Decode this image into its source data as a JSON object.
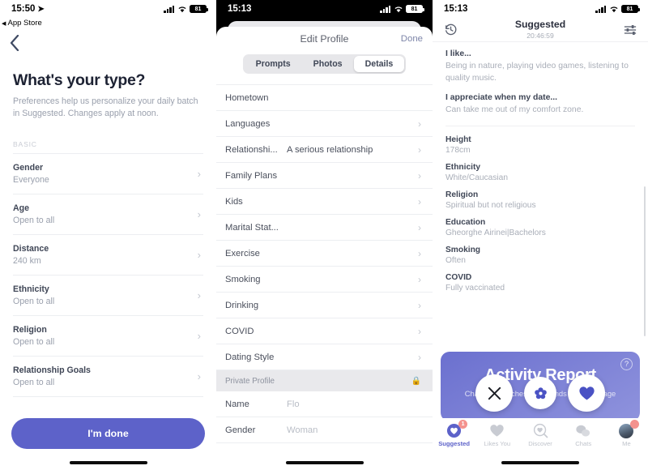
{
  "screen1": {
    "status": {
      "time": "15:50",
      "back_app": "App Store",
      "battery": "81"
    },
    "back_icon": "chevron-left-icon",
    "title": "What's your type?",
    "subtitle": "Preferences help us personalize your daily batch in Suggested. Changes apply at noon.",
    "section_label": "BASIC",
    "rows": [
      {
        "label": "Gender",
        "value": "Everyone"
      },
      {
        "label": "Age",
        "value": "Open to all"
      },
      {
        "label": "Distance",
        "value": "240 km"
      },
      {
        "label": "Ethnicity",
        "value": "Open to all"
      },
      {
        "label": "Religion",
        "value": "Open to all"
      },
      {
        "label": "Relationship Goals",
        "value": "Open to all"
      }
    ],
    "cta_label": "I'm done",
    "accent": "#5d62c9"
  },
  "screen2": {
    "status": {
      "time": "15:13",
      "battery": "81"
    },
    "sheet_title": "Edit Profile",
    "done_label": "Done",
    "tabs": [
      {
        "label": "Prompts",
        "active": false
      },
      {
        "label": "Photos",
        "active": false
      },
      {
        "label": "Details",
        "active": true
      }
    ],
    "rows": [
      {
        "label": "Hometown",
        "value": "",
        "chevron": false
      },
      {
        "label": "Languages",
        "value": "",
        "chevron": true
      },
      {
        "label": "Relationshi...",
        "value": "A serious relationship",
        "chevron": true
      },
      {
        "label": "Family Plans",
        "value": "",
        "chevron": true
      },
      {
        "label": "Kids",
        "value": "",
        "chevron": true
      },
      {
        "label": "Marital Stat...",
        "value": "",
        "chevron": true
      },
      {
        "label": "Exercise",
        "value": "",
        "chevron": true
      },
      {
        "label": "Smoking",
        "value": "",
        "chevron": true
      },
      {
        "label": "Drinking",
        "value": "",
        "chevron": true
      },
      {
        "label": "COVID",
        "value": "",
        "chevron": true
      },
      {
        "label": "Dating Style",
        "value": "",
        "chevron": true
      }
    ],
    "private_section": {
      "label": "Private Profile",
      "icon": "lock-icon"
    },
    "private_rows": [
      {
        "label": "Name",
        "value": "Flo"
      },
      {
        "label": "Gender",
        "value": "Woman"
      }
    ]
  },
  "screen3": {
    "status": {
      "time": "15:13",
      "battery": "81"
    },
    "header": {
      "left_icon": "history-rewind-icon",
      "right_icon": "filter-sliders-icon",
      "title": "Suggested",
      "timer": "20:46:59"
    },
    "prompts": [
      {
        "question": "I like...",
        "answer": "Being in nature, playing video games, listening to quality music."
      },
      {
        "question": "I appreciate when my date...",
        "answer": "Can take me out of my comfort zone."
      }
    ],
    "facts": [
      {
        "key": "Height",
        "value": "178cm"
      },
      {
        "key": "Ethnicity",
        "value": "White/Caucasian"
      },
      {
        "key": "Religion",
        "value": "Spiritual but not religious"
      },
      {
        "key": "Education",
        "value": "Gheorghe Airinei|Bachelors"
      },
      {
        "key": "Smoking",
        "value": "Often"
      },
      {
        "key": "COVID",
        "value": "Fully vaccinated"
      }
    ],
    "activity_card": {
      "title": "Activity Report",
      "subtitle": "Chat with matches and friends from the page",
      "help_icon": "question-mark-icon"
    },
    "actions": [
      {
        "name": "pass-button",
        "icon": "close-x-icon"
      },
      {
        "name": "rose-button",
        "icon": "rose-flower-icon"
      },
      {
        "name": "like-button",
        "icon": "heart-icon"
      }
    ],
    "tabs": [
      {
        "label": "Suggested",
        "icon": "heart-badge-icon",
        "badge": "1",
        "active": true
      },
      {
        "label": "Likes You",
        "icon": "heart-icon",
        "badge": "",
        "active": false
      },
      {
        "label": "Discover",
        "icon": "search-heart-icon",
        "badge": "",
        "active": false
      },
      {
        "label": "Chats",
        "icon": "chat-bubbles-icon",
        "badge": "",
        "active": false
      },
      {
        "label": "Me",
        "icon": "avatar-icon",
        "badge": " ",
        "active": false
      }
    ]
  }
}
